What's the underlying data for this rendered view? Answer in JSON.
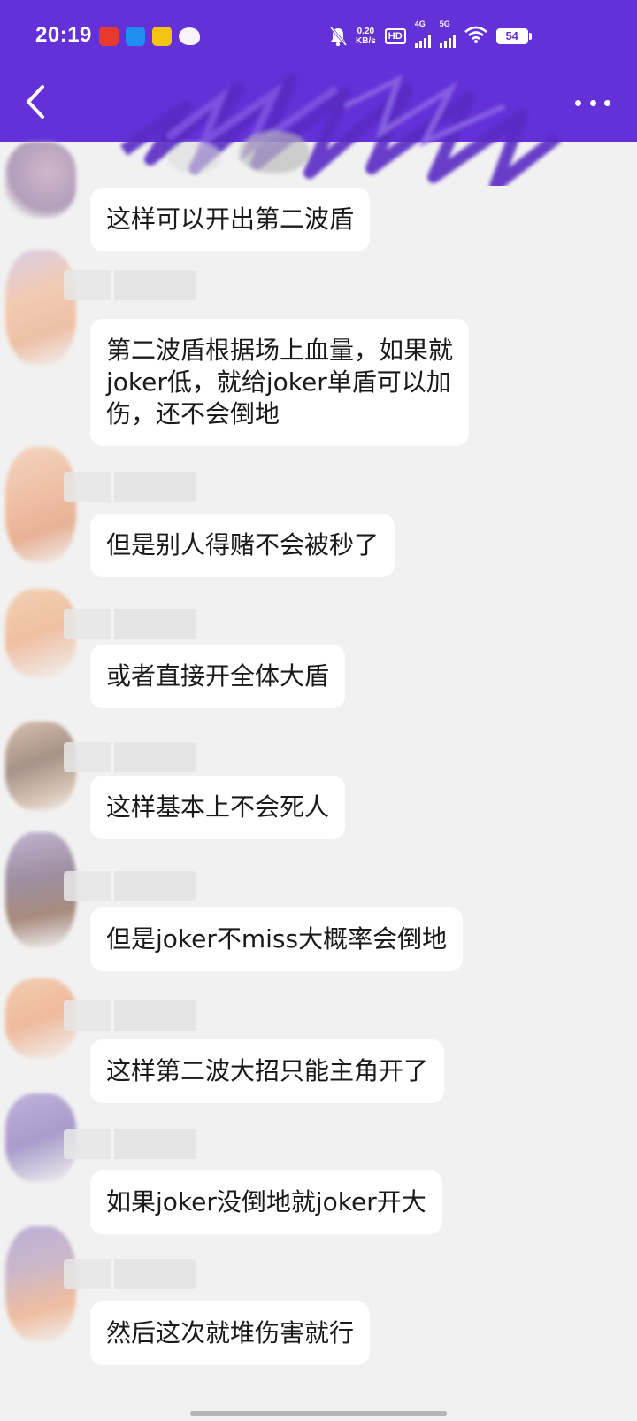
{
  "status_bar": {
    "time": "20:19",
    "net_speed_top": "0.20",
    "net_speed_bottom": "KB/s",
    "hd_label": "HD",
    "sim1_label": "4G",
    "sim2_label": "5G",
    "battery": "54",
    "app_icons": [
      "red-app-icon",
      "blue-app-icon",
      "yellow-app-icon",
      "wechat-icon"
    ]
  },
  "header": {
    "back_icon": "chevron-left-icon",
    "more_icon": "more-dots-icon"
  },
  "messages": [
    {
      "text": "这样可以开出第二波盾"
    },
    {
      "text": "第二波盾根据场上血量，如果就\njoker低，就给joker单盾可以加\n伤，还不会倒地"
    },
    {
      "text": "但是别人得赌不会被秒了"
    },
    {
      "text": "或者直接开全体大盾"
    },
    {
      "text": "这样基本上不会死人"
    },
    {
      "text": "但是joker不miss大概率会倒地"
    },
    {
      "text": "这样第二波大招只能主角开了"
    },
    {
      "text": "如果joker没倒地就joker开大"
    },
    {
      "text": "然后这次就堆伤害就行"
    }
  ],
  "colors": {
    "header_bg": "#6431d8",
    "chat_bg": "#f1f1f1",
    "bubble_bg": "#ffffff"
  }
}
